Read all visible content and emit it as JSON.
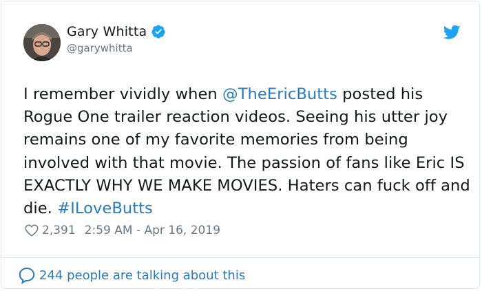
{
  "author": {
    "display_name": "Gary Whitta",
    "handle": "@garywhitta"
  },
  "tweet": {
    "text_1": "I remember vividly when ",
    "mention": "@TheEricButts",
    "text_2": " posted his Rogue One trailer reaction videos. Seeing his utter joy remains one of my favorite memories from being involved with that movie. The passion of fans like Eric IS EXACTLY WHY WE MAKE MOVIES. Haters can fuck off and die. ",
    "hashtag": "#ILoveButts"
  },
  "meta": {
    "likes": "2,391",
    "timestamp": "2:59 AM - Apr 16, 2019"
  },
  "footer": {
    "talking": "244 people are talking about this"
  },
  "icons": {
    "verified": "verified-badge-icon",
    "logo": "twitter-bird-icon",
    "like": "heart-icon",
    "reply": "speech-bubble-icon"
  },
  "colors": {
    "link": "#2b7bb9",
    "text": "#14171a",
    "secondary": "#657786",
    "twitter_blue": "#1da1f2"
  }
}
